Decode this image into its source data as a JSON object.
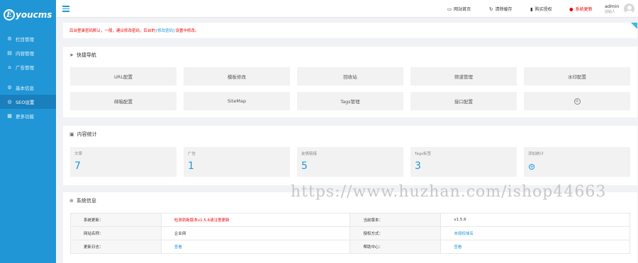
{
  "brand": {
    "logo_letter": "E",
    "logo_text": "youcms"
  },
  "sidebar": {
    "items": [
      {
        "label": "栏目管理",
        "icon": "sitemap-icon"
      },
      {
        "label": "内容管理",
        "icon": "document-icon"
      },
      {
        "label": "广告管理",
        "icon": "megaphone-icon"
      },
      {
        "label": "基本信息",
        "icon": "gear-icon"
      },
      {
        "label": "SEO设置",
        "icon": "globe-icon"
      },
      {
        "label": "更多功能",
        "icon": "grid-icon"
      }
    ],
    "active_index": 4
  },
  "topbar": {
    "links": [
      {
        "label": "网站首页",
        "icon": "monitor-icon"
      },
      {
        "label": "清除缓存",
        "icon": "refresh-icon"
      },
      {
        "label": "购买授权",
        "icon": "bookmark-icon"
      },
      {
        "label": "系统更新",
        "icon": "alert-icon"
      }
    ],
    "user_name": "admin",
    "user_role": "创始人"
  },
  "notice": {
    "text_before": "后台登录密码默认，一般，建议修改密码，后台的",
    "link": "[修改密码]",
    "text_after": "设置中修改。"
  },
  "quick_nav": {
    "title": "快捷导航",
    "buttons": [
      "URL配置",
      "模板修改",
      "回收站",
      "频道管理",
      "水印配置",
      "邮箱配置",
      "SiteMap",
      "Tags管理",
      "接口配置",
      "+"
    ]
  },
  "stats": {
    "title": "内容统计",
    "cards": [
      {
        "label": "文章",
        "value": "7"
      },
      {
        "label": "广告",
        "value": "1"
      },
      {
        "label": "友情链接",
        "value": "5"
      },
      {
        "label": "Tags标签",
        "value": "3"
      },
      {
        "label": "添加统计",
        "value": "+"
      }
    ]
  },
  "sysinfo": {
    "title": "系统信息",
    "rows": [
      {
        "k1": "系统更新：",
        "v1": "检测到新版本v1.5.6请注意更新",
        "k2": "当前版本：",
        "v2": "v1.5.6"
      },
      {
        "k1": "网站名称：",
        "v1": "企业网",
        "k2": "授权方式：",
        "v2": "未授权域名"
      },
      {
        "k1": "更新日志：",
        "v1": "查看",
        "k2": "帮助中心：",
        "v2": "查看"
      }
    ]
  },
  "watermark": "https://www.huzhan.com/ishop44663",
  "colors": {
    "accent": "#2196d6",
    "sidebar_bg": "#2196d6",
    "warning": "#e00000"
  }
}
